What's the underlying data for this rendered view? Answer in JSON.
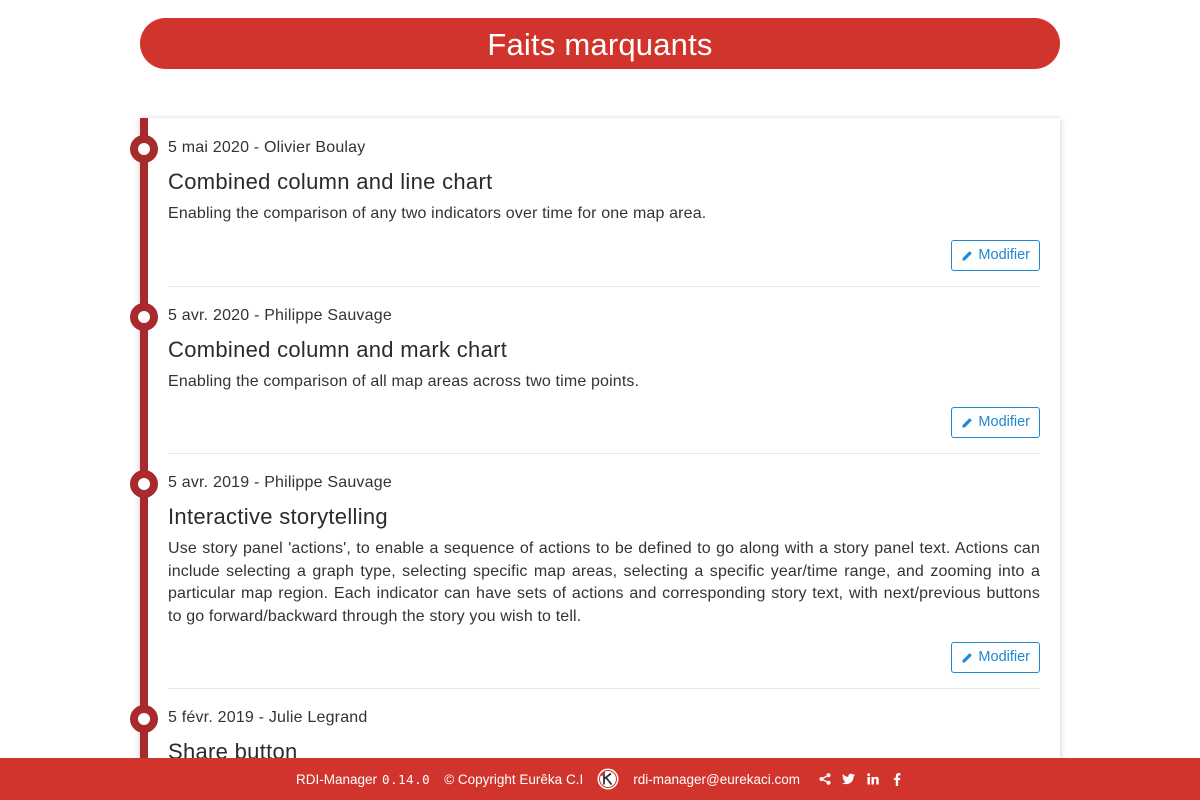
{
  "header": {
    "title": "Faits marquants"
  },
  "entries": [
    {
      "meta": "5 mai 2020 - Olivier Boulay",
      "title": "Combined column and line chart",
      "description": "Enabling the comparison of any two indicators over time for one map area.",
      "button_label": "Modifier"
    },
    {
      "meta": "5 avr. 2020 - Philippe Sauvage",
      "title": "Combined column and mark chart",
      "description": "Enabling the comparison of all map areas across two time points.",
      "button_label": "Modifier"
    },
    {
      "meta": "5 avr. 2019 - Philippe Sauvage",
      "title": "Interactive storytelling",
      "description": "Use story panel 'actions', to enable a sequence of actions to be defined to go along with a story panel text. Actions can include selecting a graph type, selecting specific map areas, selecting a specific year/time range, and zooming into a particular map region. Each indicator can have sets of actions and corresponding story text, with next/previous buttons to go forward/backward through the story you wish to tell.",
      "button_label": "Modifier"
    },
    {
      "meta": "5 févr. 2019 - Julie Legrand",
      "title": "Share button"
    }
  ],
  "footer": {
    "app_name": "RDI-Manager",
    "version": "0.14.0",
    "copyright": "© Copyright Eurêka C.I",
    "email": "rdi-manager@eurekaci.com",
    "social_icons": [
      "share-icon",
      "twitter-icon",
      "linkedin-icon",
      "facebook-icon"
    ]
  },
  "colors": {
    "brand_red": "#d0342c",
    "timeline_red": "#a82a2c",
    "link_blue": "#1e88d2"
  }
}
